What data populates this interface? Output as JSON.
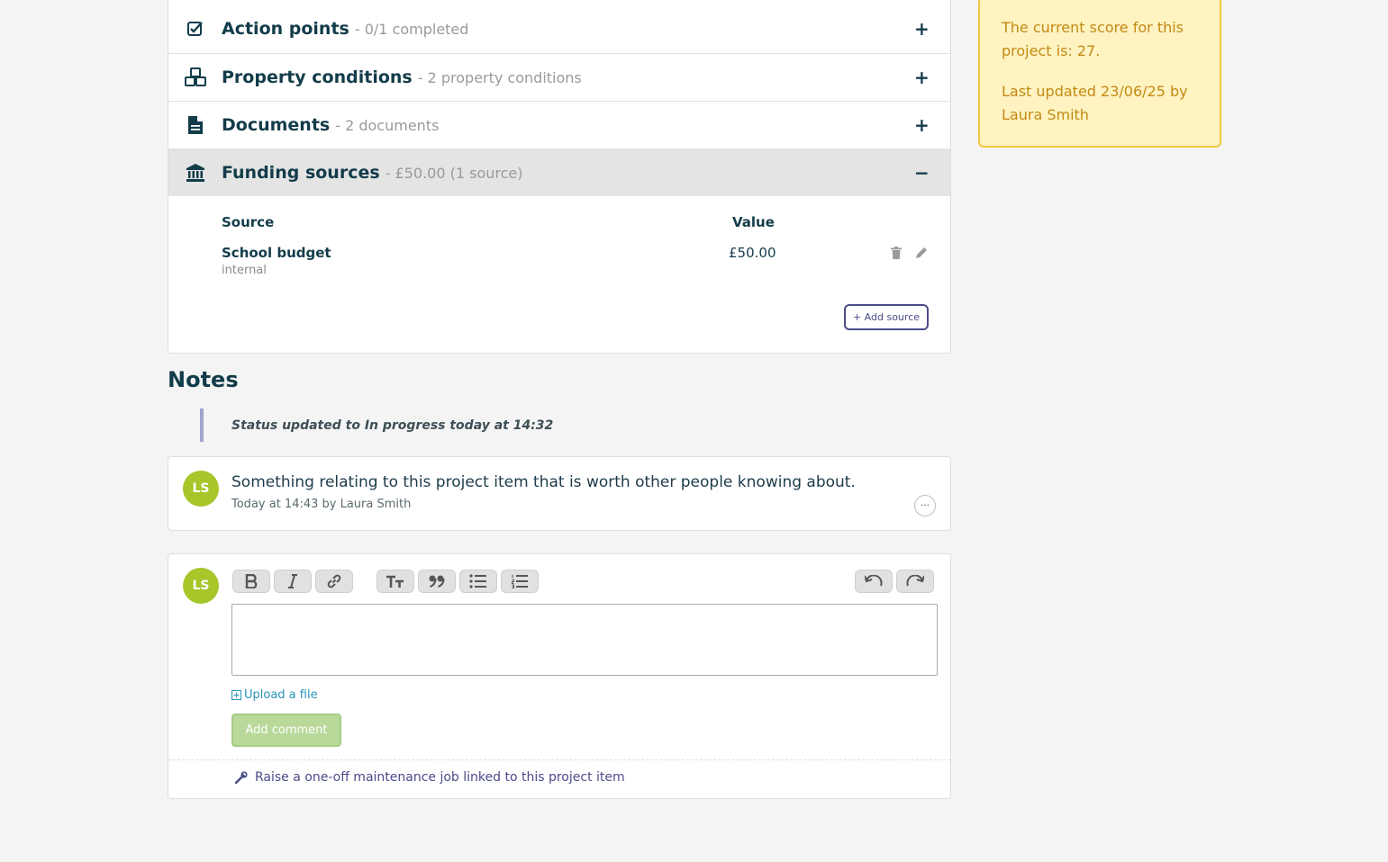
{
  "sections": [
    {
      "title": "Action points",
      "subtitle": "- 0/1 completed",
      "toggle": "+",
      "icon": "checkbox-icon"
    },
    {
      "title": "Property conditions",
      "subtitle": "- 2 property conditions",
      "toggle": "+",
      "icon": "cubes-icon"
    },
    {
      "title": "Documents",
      "subtitle": "- 2 documents",
      "toggle": "+",
      "icon": "document-icon"
    },
    {
      "title": "Funding sources",
      "subtitle": "- £50.00 (1 source)",
      "toggle": "−",
      "icon": "bank-icon"
    }
  ],
  "funding": {
    "headers": {
      "source": "Source",
      "value": "Value"
    },
    "rows": [
      {
        "name": "School budget",
        "type": "internal",
        "value": "£50.00"
      }
    ],
    "add_label": "+ Add source"
  },
  "notes": {
    "title": "Notes",
    "status_note": "Status updated to In progress today at 14:32",
    "comment": {
      "avatar": "LS",
      "text": "Something relating to this project item that is worth other people knowing about.",
      "meta": "Today at 14:43 by Laura Smith",
      "more": "···"
    }
  },
  "composer": {
    "avatar": "LS",
    "upload_label": "Upload a file",
    "submit_label": "Add comment",
    "raise_label": "Raise a one-off maintenance job linked to this project item"
  },
  "score": {
    "line1": "The current score for this project is: 27.",
    "line2": "Last updated 23/06/25 by Laura Smith"
  },
  "colors": {
    "accent": "#4b4b89",
    "avatar": "#a6c62a",
    "score_bg": "#fff3c2",
    "score_border": "#f2c640"
  }
}
